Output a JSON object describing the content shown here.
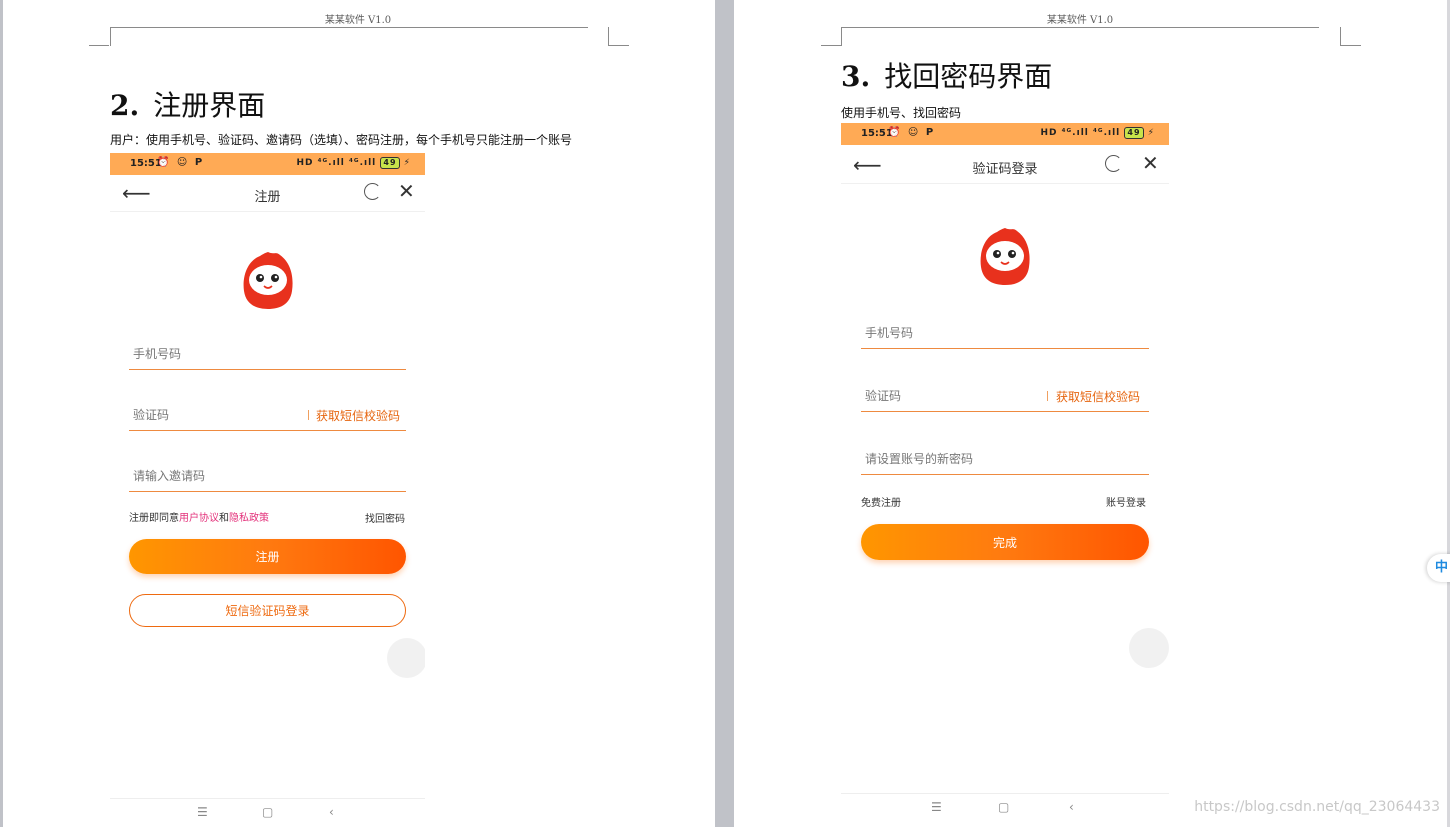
{
  "doc": {
    "header": "某某软件 V1.0",
    "watermark": "https://blog.csdn.net/qq_23064433",
    "side_tab": "中"
  },
  "section2": {
    "number": "2.",
    "title": "注册界面",
    "desc": "用户：使用手机号、验证码、邀请码（选填）、密码注册，每个手机号只能注册一个账号"
  },
  "section3": {
    "number": "3.",
    "title": "找回密码界面",
    "desc": "使用手机号、找回密码"
  },
  "status": {
    "time": "15:51",
    "icons": "⏰ ☺ P",
    "right": "HD ⁴ᴳ.ıll ⁴ᴳ.ıll",
    "battery": "49"
  },
  "register": {
    "title": "注册",
    "phone_placeholder": "手机号码",
    "code_placeholder": "验证码",
    "get_code": "获取短信校验码",
    "invite_placeholder": "请输入邀请码",
    "agree_prefix": "注册即同意",
    "user_agreement": "用户协议",
    "and": "和",
    "privacy": "隐私政策",
    "find_password": "找回密码",
    "submit": "注册",
    "sms_login": "短信验证码登录"
  },
  "recover": {
    "title": "验证码登录",
    "phone_placeholder": "手机号码",
    "code_placeholder": "验证码",
    "get_code": "获取短信校验码",
    "password_placeholder": "请设置账号的新密码",
    "free_register": "免费注册",
    "account_login": "账号登录",
    "submit": "完成"
  },
  "colors": {
    "status_bar": "#ffaa55",
    "accent": "#ff6a00",
    "link": "#e3327b"
  }
}
